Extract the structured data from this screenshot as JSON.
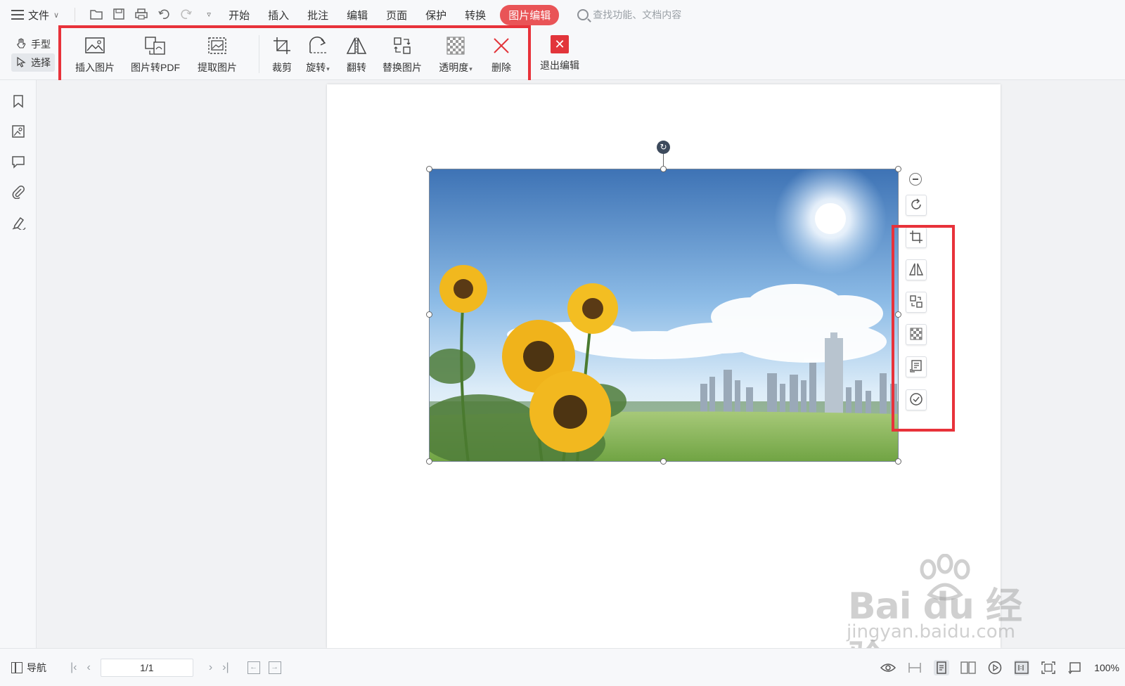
{
  "menubar": {
    "file_label": "文件",
    "tabs": [
      {
        "label": "开始"
      },
      {
        "label": "插入"
      },
      {
        "label": "批注"
      },
      {
        "label": "编辑"
      },
      {
        "label": "页面"
      },
      {
        "label": "保护"
      },
      {
        "label": "转换"
      },
      {
        "label": "图片编辑",
        "active": true
      }
    ],
    "search_placeholder": "查找功能、文档内容"
  },
  "modes": {
    "hand_label": "手型",
    "select_label": "选择"
  },
  "ribbon": {
    "tools": [
      {
        "label": "插入图片",
        "icon": "insert-image-icon"
      },
      {
        "label": "图片转PDF",
        "icon": "image-to-pdf-icon"
      },
      {
        "label": "提取图片",
        "icon": "extract-image-icon"
      },
      {
        "label": "裁剪",
        "icon": "crop-icon"
      },
      {
        "label": "旋转",
        "icon": "rotate-icon",
        "dropdown": true
      },
      {
        "label": "翻转",
        "icon": "flip-icon"
      },
      {
        "label": "替换图片",
        "icon": "replace-image-icon"
      },
      {
        "label": "透明度",
        "icon": "transparency-icon",
        "dropdown": true
      },
      {
        "label": "删除",
        "icon": "delete-icon"
      }
    ],
    "exit_label": "退出编辑"
  },
  "sidebar": {
    "icons": [
      "bookmark-icon",
      "image-panel-icon",
      "comment-icon",
      "attachment-icon",
      "signature-icon"
    ]
  },
  "floating_tools": {
    "icons": [
      "zoom-out-icon",
      "rotate-icon",
      "crop-icon",
      "flip-icon",
      "replace-image-icon",
      "transparency-icon",
      "extract-icon",
      "confirm-icon"
    ]
  },
  "watermark": {
    "main": "Bai du 经验",
    "sub": "jingyan.baidu.com"
  },
  "statusbar": {
    "nav_label": "导航",
    "page_indicator": "1/1",
    "zoom": "100%"
  },
  "colors": {
    "accent": "#e95457",
    "highlight_box": "#e8323a",
    "exit_red": "#e2353b"
  }
}
